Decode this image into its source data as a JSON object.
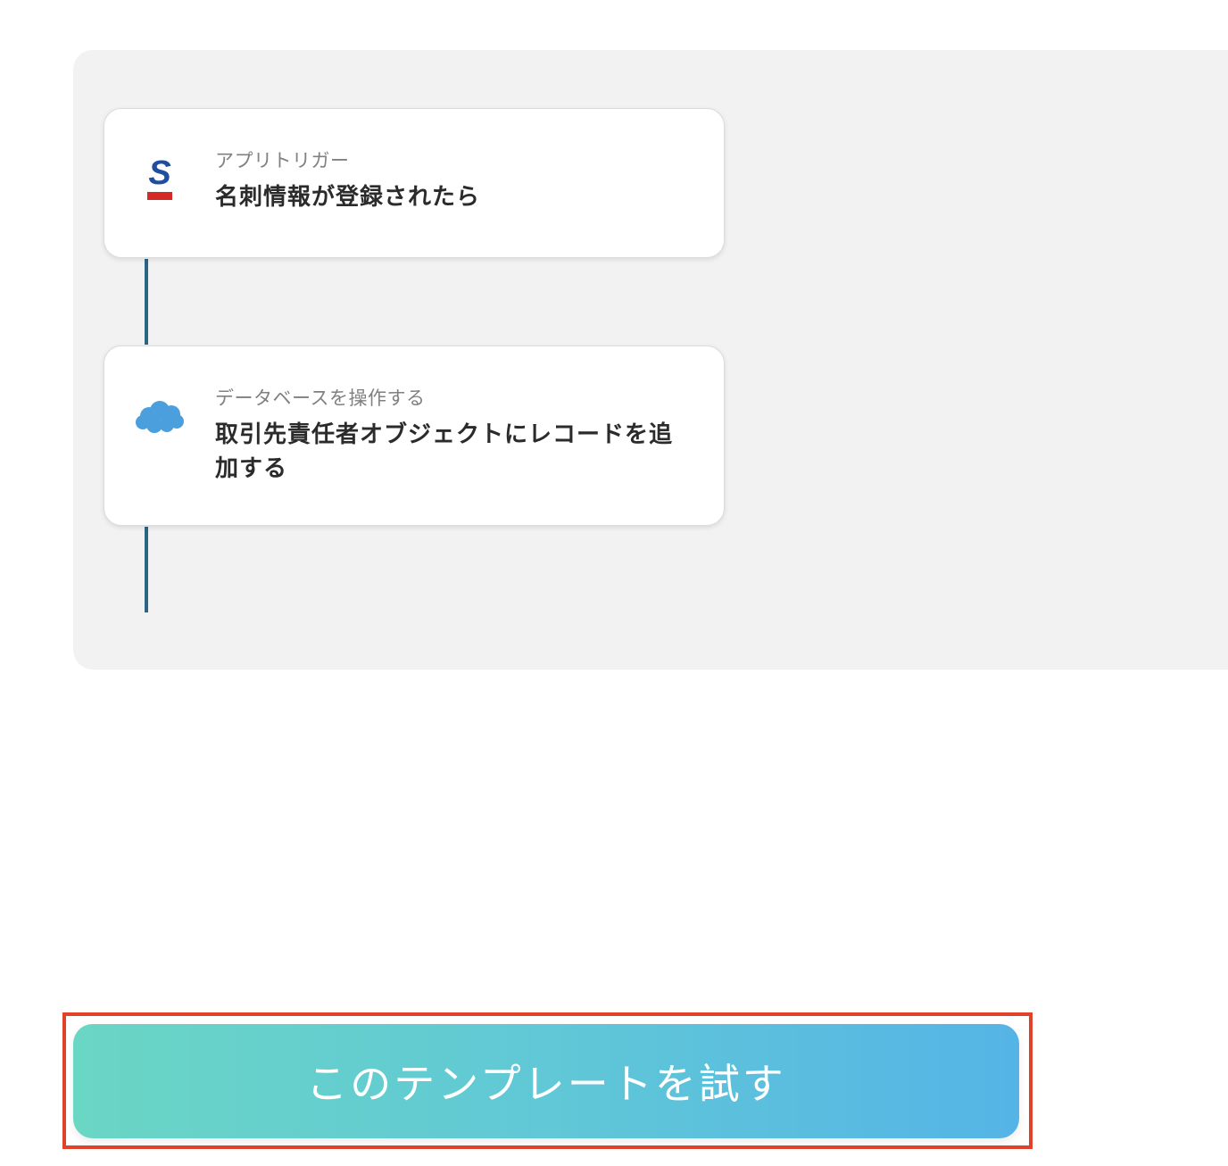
{
  "steps": [
    {
      "icon": "sansan-icon",
      "kind": "アプリトリガー",
      "title": "名刺情報が登録されたら"
    },
    {
      "icon": "salesforce-cloud-icon",
      "kind": "データベースを操作する",
      "title": "取引先責任者オブジェクトにレコードを追加する"
    }
  ],
  "cta": {
    "label": "このテンプレートを試す"
  },
  "colors": {
    "connector": "#2a6680",
    "highlight": "#e0432a",
    "cta_gradient_start": "#6ad6c4",
    "cta_gradient_end": "#55b4e6"
  }
}
